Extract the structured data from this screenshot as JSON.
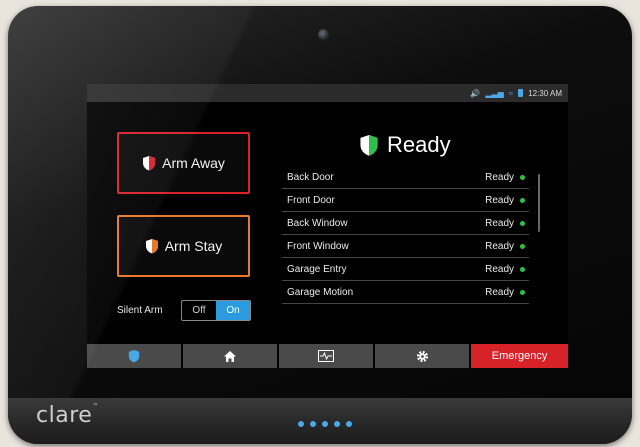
{
  "device": {
    "brand": "clare",
    "trademark": "™",
    "accent_color": "#4aa8e8"
  },
  "statusbar": {
    "icons": [
      "volume-icon",
      "signal-bars-icon",
      "wifi-icon",
      "battery-icon"
    ],
    "time": "12:30 AM"
  },
  "arm_buttons": {
    "away_label": "Arm Away",
    "away_color": "#d8222a",
    "stay_label": "Arm Stay",
    "stay_color": "#e8782a"
  },
  "silent_arm": {
    "label": "Silent Arm",
    "off_label": "Off",
    "on_label": "On",
    "selected": "On"
  },
  "status": {
    "title": "Ready",
    "color": "#2fbf4a"
  },
  "zones": [
    {
      "name": "Back Door",
      "status": "Ready"
    },
    {
      "name": "Front Door",
      "status": "Ready"
    },
    {
      "name": "Back Window",
      "status": "Ready"
    },
    {
      "name": "Front Window",
      "status": "Ready"
    },
    {
      "name": "Garage Entry",
      "status": "Ready"
    },
    {
      "name": "Garage Motion",
      "status": "Ready"
    }
  ],
  "navbar": {
    "items": [
      "shield-icon",
      "home-icon",
      "activity-icon",
      "gear-icon"
    ],
    "emergency_label": "Emergency",
    "emergency_color": "#d8222a"
  }
}
